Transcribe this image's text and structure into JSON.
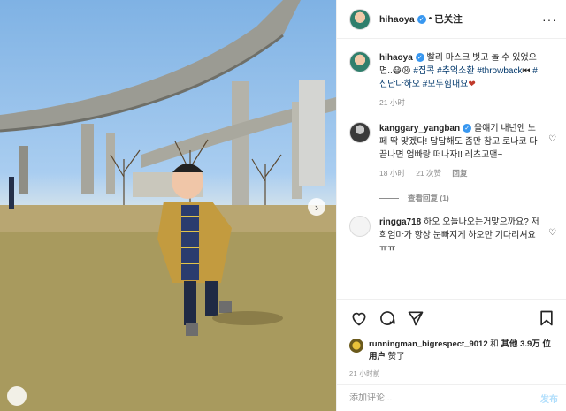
{
  "post_author": {
    "username": "hihaoya",
    "follow_status": "已关注"
  },
  "caption": {
    "username": "hihaoya",
    "text_1": "빨리 마스크 벗고 놀 수 있었으면..",
    "emoji_1": "😷😩",
    "hashtags": [
      "#집콕",
      "#추억소환",
      "#throwback",
      "#신난다하오",
      "#모두힘내요"
    ],
    "emoji_2": "⏮",
    "emoji_3": "❤",
    "time": "21 小时"
  },
  "comments": [
    {
      "username": "kanggary_yangban",
      "verified": true,
      "text": "올얘기 내년엔 노페 딱 맞겠다! 답답해도 좀만 참고 로나코 다 끝나면 엄빠랑 떠나자!! 레츠고맨~",
      "time": "18 小时",
      "likes": "21 次赞",
      "reply_label": "回复",
      "view_replies": "查看回复 (1)"
    },
    {
      "username": "ringga718",
      "verified": false,
      "text": "하오 오늘나오는거맞으까요? 저희엄마가 항상 눈빠지게 하오만 기다리셔요ㅠㅠ"
    }
  ],
  "likes": {
    "first_user": "runningman_bigrespect_9012",
    "connector": "和",
    "others": "其他 3.9万 位用户",
    "suffix": "赞了"
  },
  "post_time": "21 小时前",
  "add_comment": {
    "placeholder": "添加评论...",
    "post_label": "发布"
  },
  "icons": {
    "like": "heart-icon",
    "comment": "comment-icon",
    "share": "share-icon",
    "save": "bookmark-icon",
    "more": "more-icon",
    "next": "chevron-right-icon"
  },
  "colors": {
    "hashtag": "#00376b",
    "verified": "#3897f0",
    "post_button": "#b2dffc",
    "meta": "#8e8e8e"
  }
}
